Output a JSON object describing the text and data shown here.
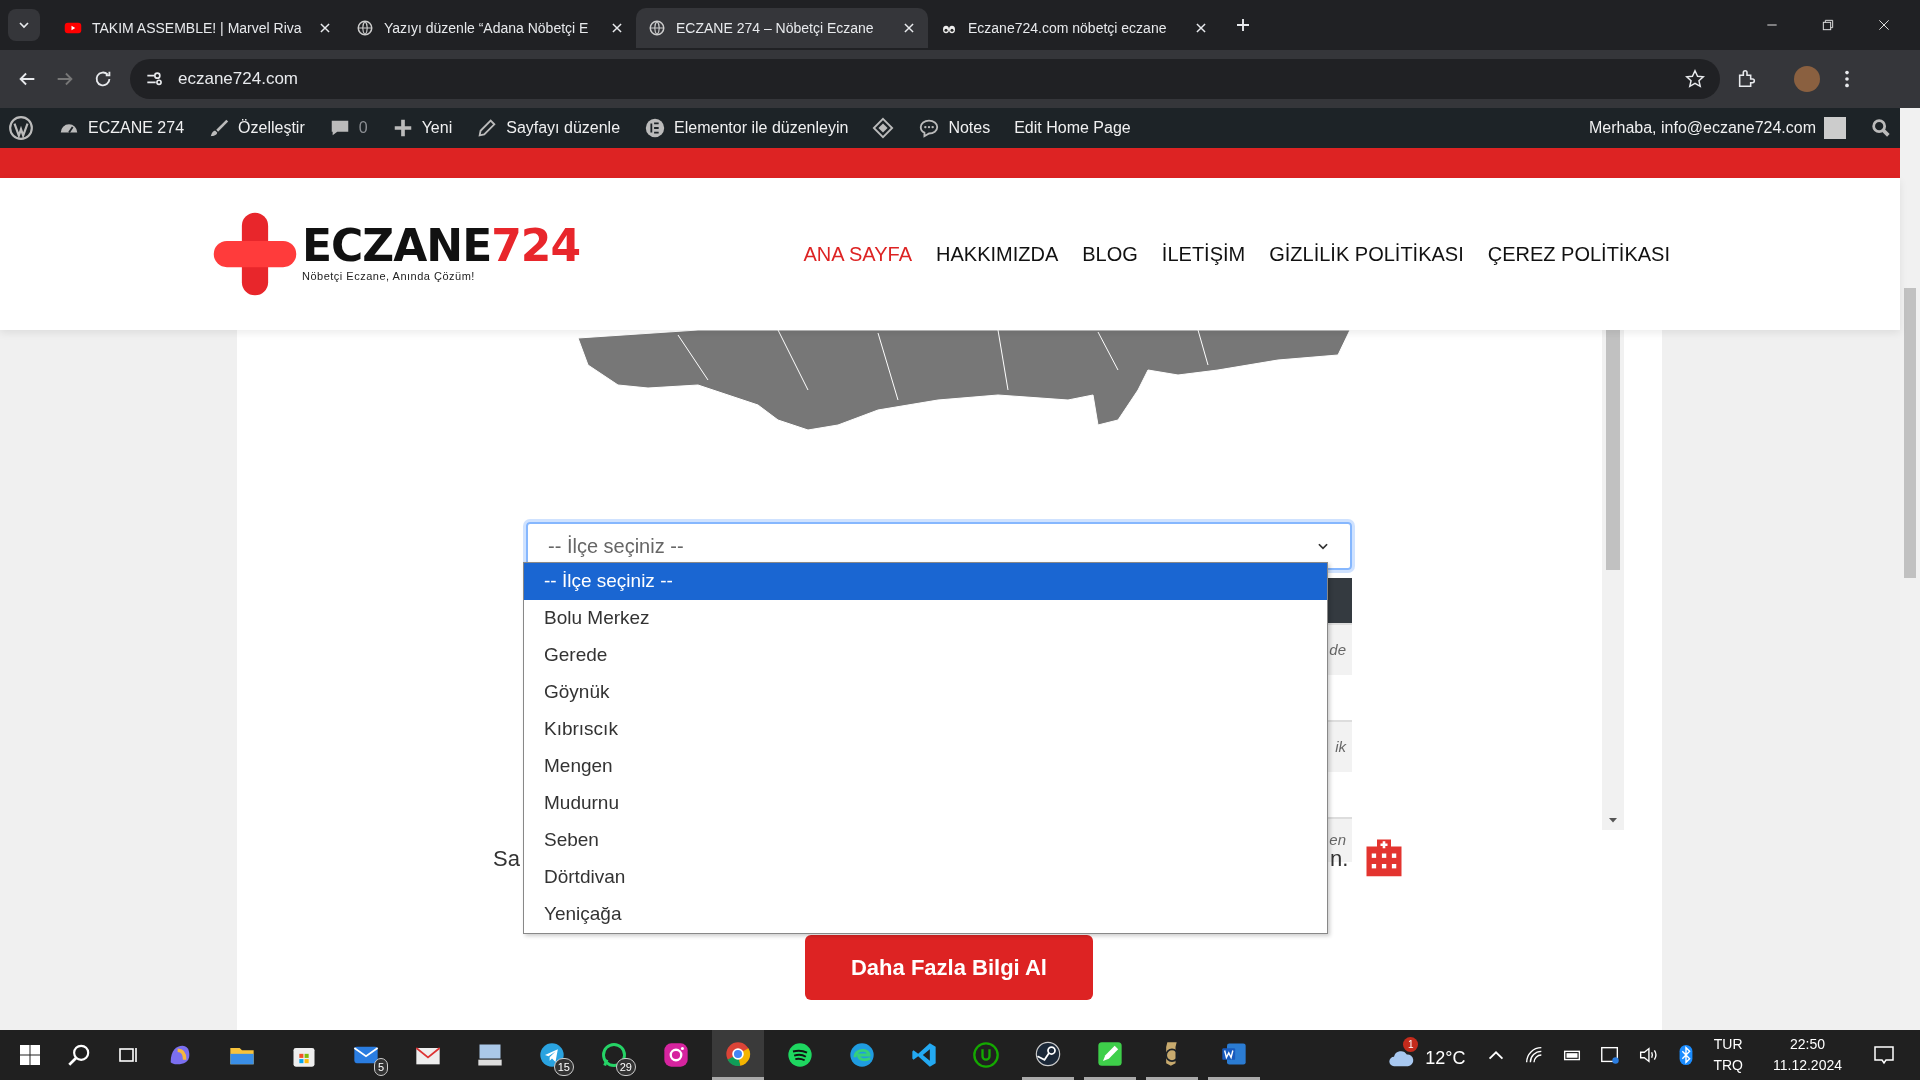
{
  "browser": {
    "tabs": [
      {
        "title": "TAKIM ASSEMBLE! | Marvel Riva",
        "kind": "video",
        "selected": false
      },
      {
        "title": "Yazıyı düzenle “Adana Nöbetçi E",
        "kind": "globe",
        "selected": false
      },
      {
        "title": "ECZANE 274 – Nöbetçi Eczane",
        "kind": "globe",
        "selected": true
      },
      {
        "title": "Eczane724.com nöbetçi eczane",
        "kind": "bug",
        "selected": false
      }
    ],
    "url": "eczane724.com"
  },
  "admin_bar": {
    "items": [
      {
        "label": "ECZANE 274",
        "kind": "gauge"
      },
      {
        "label": "Özelleştir",
        "kind": "brush"
      },
      {
        "label": "0",
        "kind": "comment"
      },
      {
        "label": "Yeni",
        "kind": "plus"
      },
      {
        "label": "Sayfayı düzenle",
        "kind": "pencil"
      },
      {
        "label": "Elementor ile düzenleyin",
        "kind": "elementor"
      },
      {
        "kind": "diamond"
      },
      {
        "label": "Notes",
        "kind": "bubble"
      },
      {
        "label": "Edit Home Page",
        "kind": "none"
      }
    ],
    "greeting": "Merhaba, info@eczane724.com"
  },
  "header": {
    "logo": {
      "word": "ECZANE",
      "number": "724",
      "tagline": "Nöbetçi Eczane, Anında Çözüm!"
    },
    "nav": [
      {
        "label": "ANA SAYFA",
        "selected": true
      },
      {
        "label": "HAKKIMIZDA",
        "selected": false
      },
      {
        "label": "BLOG",
        "selected": false
      },
      {
        "label": "İLETİŞİM",
        "selected": false
      },
      {
        "label": "GİZLİLİK POLİTİKASI",
        "selected": false
      },
      {
        "label": "ÇEREZ POLİTİKASI",
        "selected": false
      }
    ]
  },
  "district_select": {
    "value": "-- İlçe seçiniz --",
    "options": [
      {
        "label": "-- İlçe seçiniz --",
        "selected": true
      },
      {
        "label": "Bolu Merkez",
        "selected": false
      },
      {
        "label": "Gerede",
        "selected": false
      },
      {
        "label": "Göynük",
        "selected": false
      },
      {
        "label": "Kıbrıscık",
        "selected": false
      },
      {
        "label": "Mengen",
        "selected": false
      },
      {
        "label": "Mudurnu",
        "selected": false
      },
      {
        "label": "Seben",
        "selected": false
      },
      {
        "label": "Dörtdivan",
        "selected": false
      },
      {
        "label": "Yeniçağa",
        "selected": false
      }
    ]
  },
  "hidden_rows": [
    {
      "kind": "header"
    },
    {
      "kind": "row",
      "text": "de"
    },
    {
      "kind": "gap"
    },
    {
      "kind": "row",
      "text": "ik"
    },
    {
      "kind": "gap"
    },
    {
      "kind": "row",
      "text": "en"
    }
  ],
  "sentence": {
    "start": "Sa",
    "end": "n."
  },
  "cta_button": "Daha Fazla Bilgi Al",
  "taskbar": {
    "apps": [
      {
        "kind": "copilot",
        "running": false
      },
      {
        "kind": "folder",
        "running": false
      },
      {
        "kind": "store",
        "running": false
      },
      {
        "kind": "mail",
        "badge": "5",
        "running": false
      },
      {
        "kind": "envelope",
        "running": false
      },
      {
        "kind": "computer",
        "running": false
      },
      {
        "kind": "telegram",
        "badge": "15",
        "running": false
      },
      {
        "kind": "whatsapp",
        "badge": "29",
        "running": false
      },
      {
        "kind": "instagram",
        "running": false
      },
      {
        "kind": "chrome",
        "running": true
      },
      {
        "kind": "spotify",
        "running": false
      },
      {
        "kind": "edge",
        "running": false
      },
      {
        "kind": "vscode",
        "running": false
      },
      {
        "kind": "upwork",
        "running": false
      },
      {
        "kind": "steam",
        "running": true
      },
      {
        "kind": "pen",
        "running": true
      },
      {
        "kind": "league",
        "running": true
      },
      {
        "kind": "word",
        "running": true
      }
    ],
    "weather_badge": "1",
    "temperature": "12°C",
    "lang1": "TUR",
    "lang2": "TRQ",
    "time": "22:50",
    "date": "11.12.2024"
  }
}
